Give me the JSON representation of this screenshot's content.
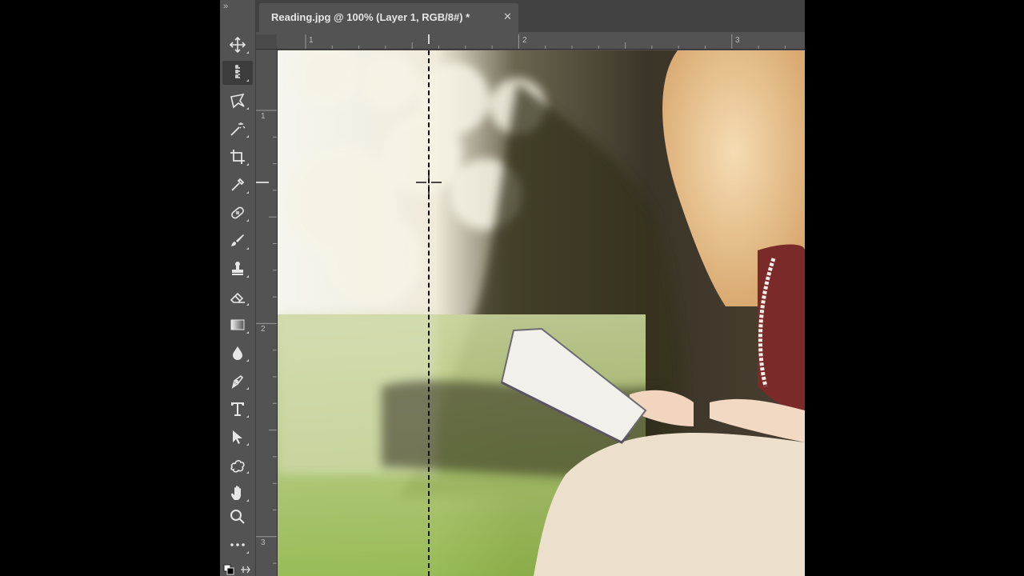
{
  "document": {
    "tab_title": "Reading.jpg @ 100% (Layer 1, RGB/8#) *",
    "close_glyph": "✕"
  },
  "toolbar": {
    "collapse_glyph": "››",
    "tools": [
      {
        "name": "move-tool-icon"
      },
      {
        "name": "single-column-marquee-tool-icon",
        "active": true
      },
      {
        "name": "polygonal-lasso-tool-icon"
      },
      {
        "name": "magic-wand-tool-icon"
      },
      {
        "name": "crop-tool-icon"
      },
      {
        "name": "eyedropper-tool-icon"
      },
      {
        "name": "healing-brush-tool-icon"
      },
      {
        "name": "brush-tool-icon"
      },
      {
        "name": "clone-stamp-tool-icon"
      },
      {
        "name": "eraser-tool-icon"
      },
      {
        "name": "gradient-tool-icon"
      },
      {
        "name": "blur-tool-icon"
      },
      {
        "name": "pen-tool-icon"
      },
      {
        "name": "type-tool-icon"
      },
      {
        "name": "path-selection-tool-icon"
      },
      {
        "name": "custom-shape-tool-icon"
      },
      {
        "name": "hand-tool-icon"
      },
      {
        "name": "zoom-tool-icon"
      },
      {
        "name": "more-tools-icon"
      }
    ]
  },
  "ruler_top": {
    "labels": [
      "1",
      "2",
      "3"
    ]
  },
  "ruler_left": {
    "labels": [
      "1",
      "2",
      "3"
    ]
  },
  "colors": {
    "ui_bg": "#535353",
    "tabbar_bg": "#424242",
    "sky": "#f4f3ec",
    "tree": "#3a3528",
    "grass": "#a6c25a",
    "hair": "#e9c79a",
    "blouse": "#7a2a28",
    "skirt": "#ece0cc",
    "book": "#f2f0ea"
  }
}
